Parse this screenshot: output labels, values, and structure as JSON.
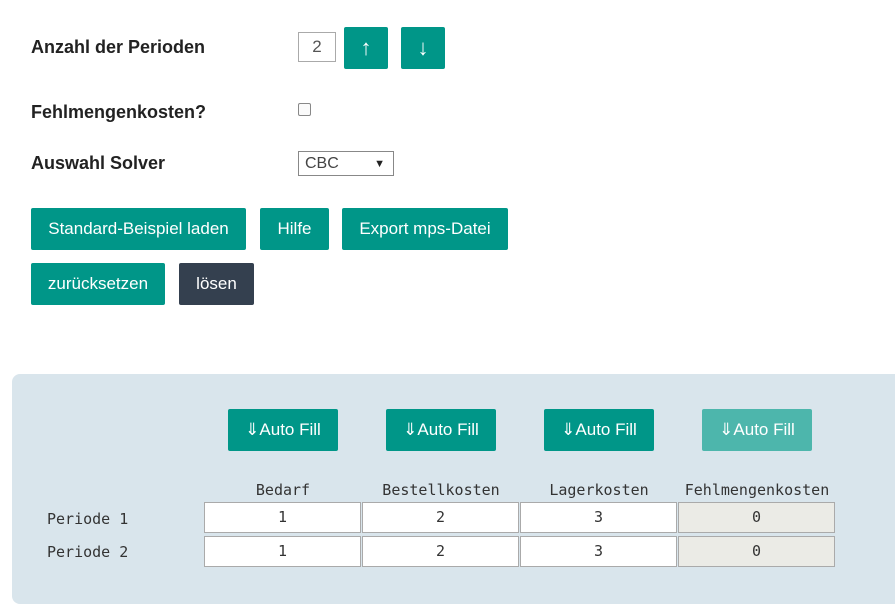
{
  "settings": {
    "periods_label": "Anzahl der Perioden",
    "periods_value": "2",
    "up_arrow": "↑",
    "down_arrow": "↓",
    "shortage_label": "Fehlmengenkosten?",
    "solver_label": "Auswahl Solver",
    "solver_value": "CBC"
  },
  "buttons": {
    "load_example": "Standard-Beispiel laden",
    "help": "Hilfe",
    "export": "Export mps-Datei",
    "reset": "zurücksetzen",
    "solve": "lösen"
  },
  "table": {
    "autofill_label": "⇓Auto Fill",
    "columns": [
      "Bedarf",
      "Bestellkosten",
      "Lagerkosten",
      "Fehlmengenkosten"
    ],
    "rows": [
      {
        "label": "Periode 1",
        "cells": [
          "1",
          "2",
          "3",
          "0"
        ]
      },
      {
        "label": "Periode 2",
        "cells": [
          "1",
          "2",
          "3",
          "0"
        ]
      }
    ]
  }
}
